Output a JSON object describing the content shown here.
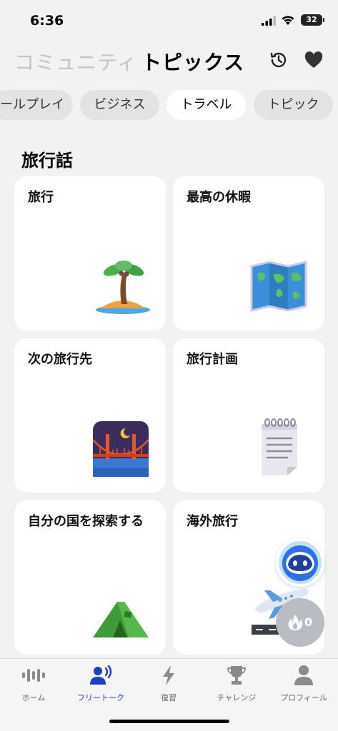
{
  "status": {
    "time": "6:36",
    "battery": "32"
  },
  "header": {
    "tab_community": "コミュニティ",
    "tab_topics": "トピックス",
    "history_icon": "history-icon",
    "heart_icon": "heart-icon"
  },
  "chips": [
    "ールプレイ",
    "ビジネス",
    "トラベル",
    "トピック"
  ],
  "active_chip": "トラベル",
  "section": {
    "title": "旅行話"
  },
  "cards": [
    {
      "title": "旅行",
      "icon": "palm-island-icon"
    },
    {
      "title": "最高の休暇",
      "icon": "world-map-icon"
    },
    {
      "title": "次の旅行先",
      "icon": "bridge-night-icon"
    },
    {
      "title": "旅行計画",
      "icon": "notepad-icon"
    },
    {
      "title": "自分の国を探索する",
      "icon": "camping-tent-icon"
    },
    {
      "title": "海外旅行",
      "icon": "airplane-departure-icon"
    }
  ],
  "floating": {
    "streak_count": "0"
  },
  "tabbar": {
    "items": [
      {
        "label": "ホーム",
        "icon": "waveform-icon"
      },
      {
        "label": "フリートーク",
        "icon": "speaking-person-icon"
      },
      {
        "label": "復習",
        "icon": "lightning-icon"
      },
      {
        "label": "チャレンジ",
        "icon": "trophy-icon"
      },
      {
        "label": "プロフィール",
        "icon": "person-icon"
      }
    ],
    "active": "フリートーク"
  },
  "colors": {
    "accent": "#1f3fbf",
    "background": "#f2f2f2",
    "card": "#ffffff",
    "chip": "#e3e3e3"
  }
}
